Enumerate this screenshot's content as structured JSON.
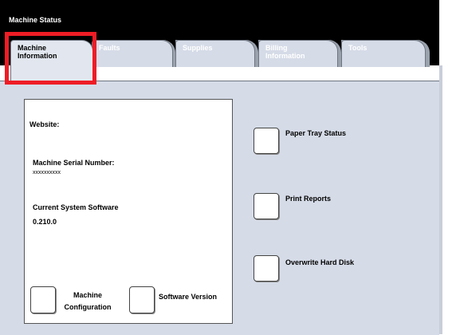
{
  "window": {
    "title": "Machine Status"
  },
  "tabs": [
    {
      "label": "Machine\nInformation",
      "active": true
    },
    {
      "label": "Faults",
      "active": false
    },
    {
      "label": "Supplies",
      "active": false
    },
    {
      "label": "Billing\nInformation",
      "active": false
    },
    {
      "label": "Tools",
      "active": false
    }
  ],
  "info": {
    "website_label": "Website:",
    "serial_label": "Machine Serial Number:",
    "serial_value": "xxxxxxxxxx",
    "software_label": "Current System Software",
    "software_value": "0.210.0"
  },
  "bottom_buttons": {
    "machine_configuration": "Machine\nConfiguration",
    "software_version": "Software Version"
  },
  "right_buttons": {
    "paper_tray_status": "Paper Tray Status",
    "print_reports": "Print Reports",
    "overwrite_hard_disk": "Overwrite Hard Disk"
  },
  "colors": {
    "highlight": "#ee1c25",
    "panel": "#d5dbe7",
    "titlebar": "#000000"
  }
}
